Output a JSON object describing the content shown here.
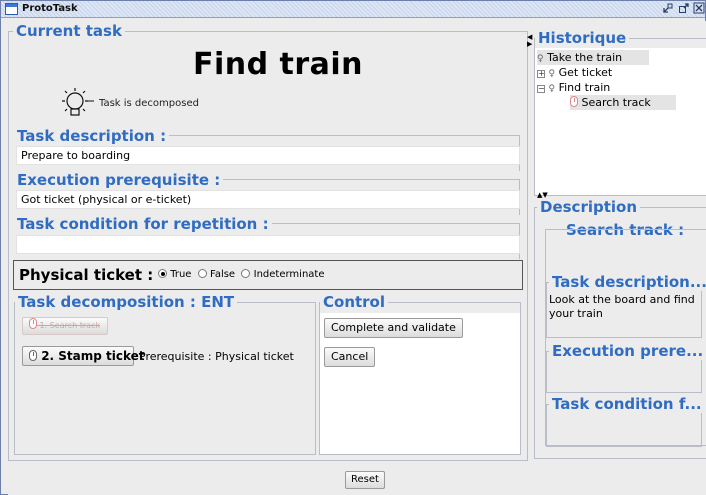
{
  "window": {
    "title": "ProtoTask",
    "btn_minimize": "▫",
    "btn_maximize": "▫",
    "btn_close": "×"
  },
  "current_task": {
    "group_title": "Current task",
    "task_name": "Find train",
    "decomposed_label": "Task is decomposed"
  },
  "task_description": {
    "title": "Task description :",
    "value": "Prepare to boarding"
  },
  "execution_prerequisite": {
    "title": "Execution prerequisite :",
    "value": "Got ticket (physical or e-ticket)"
  },
  "task_condition": {
    "title": "Task condition for repetition :",
    "value": ""
  },
  "physical_ticket": {
    "label": "Physical ticket :",
    "options": [
      "True",
      "False",
      "Indeterminate"
    ],
    "selected": "True"
  },
  "decomposition": {
    "title": "Task decomposition : ENT",
    "step1_label": "1. Search track",
    "step2_label": "2. Stamp ticket",
    "step2_prereq": "Prerequisite : Physical ticket"
  },
  "control": {
    "title": "Control",
    "complete_label": "Complete and validate",
    "cancel_label": "Cancel"
  },
  "reset_label": "Reset",
  "historique": {
    "title": "Historique",
    "items": [
      {
        "label": "Take the train"
      },
      {
        "label": "Get ticket"
      },
      {
        "label": "Find train"
      },
      {
        "label": "Search track"
      }
    ]
  },
  "description_panel": {
    "title": "Description",
    "subtitle": "Search track :",
    "task_description_title": "Task description...",
    "task_description_value": "Look at the board and find your train",
    "execution_title": "Execution prere...",
    "condition_title": "Task condition f..."
  }
}
